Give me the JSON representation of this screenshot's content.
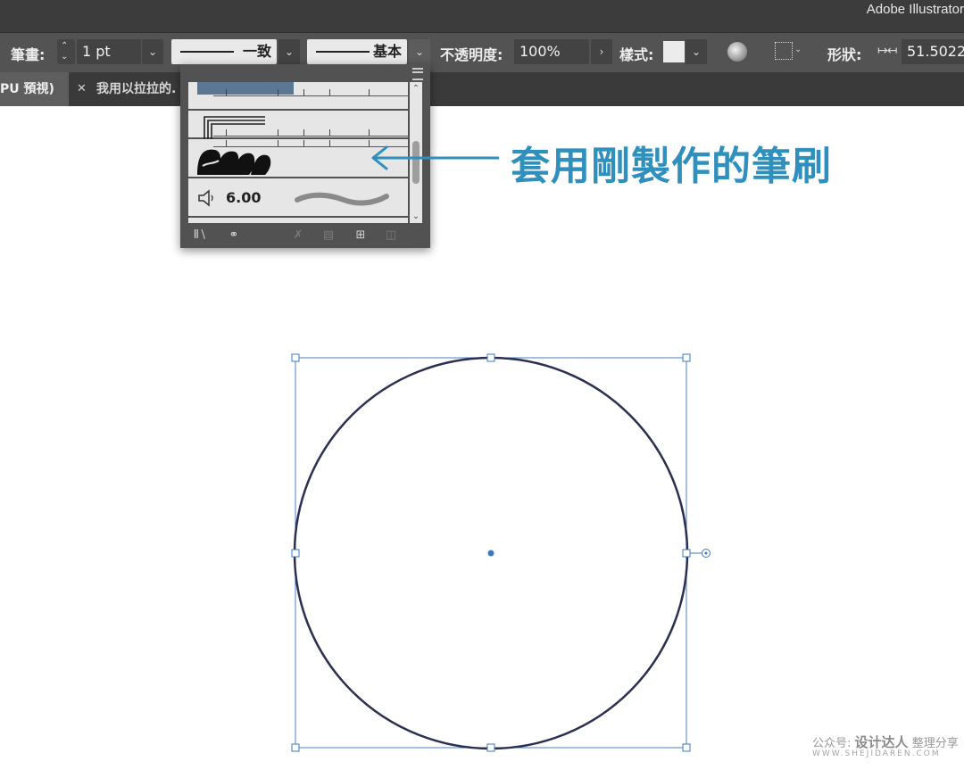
{
  "app": {
    "title": "Adobe Illustrator"
  },
  "control_bar": {
    "stroke_label": "筆畫:",
    "stroke_weight": "1 pt",
    "variable_width_label": "一致",
    "brush_label": "基本",
    "opacity_label": "不透明度:",
    "opacity_value": "100%",
    "style_label": "樣式:",
    "shape_label": "形狀:",
    "width_value": "51.5022"
  },
  "tabs": [
    {
      "label": "PU 預視)"
    },
    {
      "label": "我用以拉拉的."
    }
  ],
  "brush_panel": {
    "selected_brush_size": "6.00"
  },
  "annotation": {
    "text": "套用剛製作的筆刷"
  },
  "watermark": {
    "line1_prefix": "公众号:",
    "brand": "设计达人",
    "line1_suffix": "整理分享",
    "line2": "WWW.SHEJIDAREN.COM"
  },
  "colors": {
    "annotation": "#2f8fbd",
    "selection": "#3b78c4",
    "shape_stroke": "#2b2f52"
  },
  "icons": [
    "spinner-icon",
    "chevron-down-icon",
    "chevron-right-icon",
    "globe-icon",
    "align-icon",
    "width-icon",
    "panel-menu-icon",
    "brush-library-icon",
    "cc-library-icon",
    "remove-stroke-icon",
    "options-icon",
    "new-brush-icon",
    "trash-icon",
    "close-icon",
    "speaker-icon"
  ]
}
